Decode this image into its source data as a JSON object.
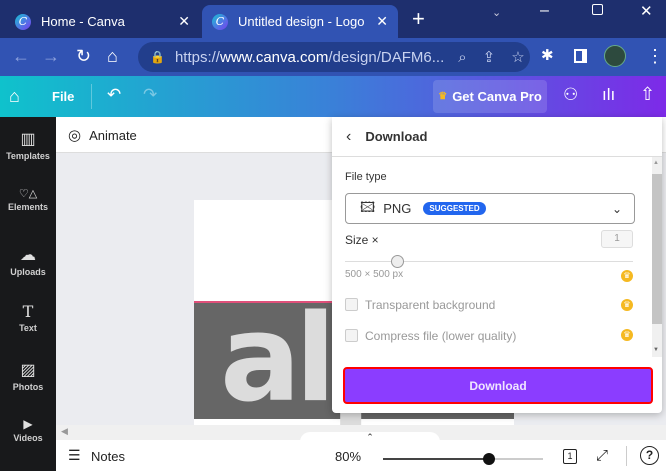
{
  "browser": {
    "tabs": [
      {
        "title": "Home - Canva",
        "active": false
      },
      {
        "title": "Untitled design - Logo",
        "active": true
      }
    ],
    "new_tab": "+",
    "url_prefix": "https://",
    "url_host": "www.canva.com",
    "url_path": "/design/DAFM6..."
  },
  "toolbar": {
    "file": "File",
    "get_pro": "Get Canva Pro"
  },
  "sidebar": {
    "items": [
      {
        "label": "Templates",
        "icon": "▥"
      },
      {
        "label": "Elements",
        "icon": "♡△"
      },
      {
        "label": "Uploads",
        "icon": "☁"
      },
      {
        "label": "Text",
        "icon": "T"
      },
      {
        "label": "Photos",
        "icon": "▨"
      },
      {
        "label": "Videos",
        "icon": "▶"
      }
    ]
  },
  "context": {
    "animate": "Animate"
  },
  "design": {
    "logo_text": "alp"
  },
  "download_panel": {
    "title": "Download",
    "file_type_label": "File type",
    "file_type": "PNG",
    "suggested": "SUGGESTED",
    "size_label": "Size ×",
    "size_value": "1",
    "size_slider_fraction": 0.18,
    "dimensions": "500 × 500 px",
    "transparent": "Transparent background",
    "compress": "Compress file (lower quality)",
    "button": "Download"
  },
  "bottom": {
    "notes": "Notes",
    "zoom": "80%",
    "zoom_fraction": 0.66,
    "page": "1",
    "help": "?"
  },
  "colors": {
    "accent": "#8b3dff",
    "highlight": "#ff0000",
    "badge": "#2266ee"
  }
}
